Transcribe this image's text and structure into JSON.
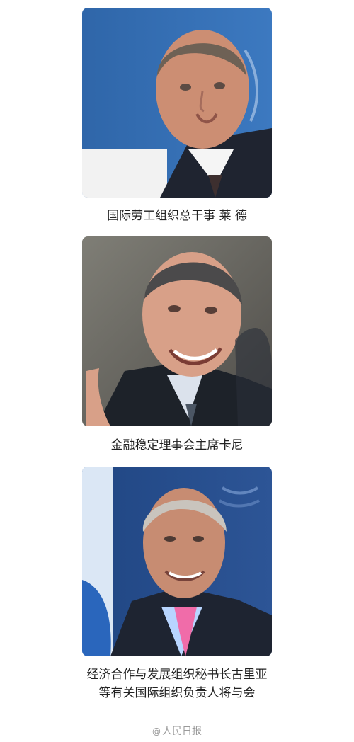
{
  "sections": [
    {
      "caption_lines": [
        "国际劳工组织总干事 莱 德"
      ]
    },
    {
      "caption_lines": [
        "金融稳定理事会主席卡尼"
      ]
    },
    {
      "caption_lines": [
        "经济合作与发展组织秘书长古里亚",
        "等有关国际组织负责人将与会"
      ]
    }
  ],
  "watermark": {
    "text": "人民日报",
    "icon": "at-icon"
  },
  "colors": {
    "caption": "#222222",
    "watermark": "#9a9a9a"
  }
}
